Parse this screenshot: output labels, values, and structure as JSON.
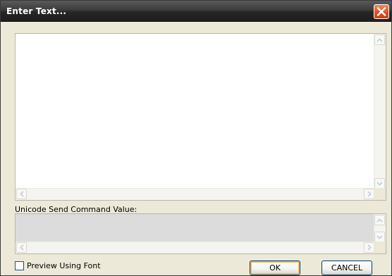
{
  "window": {
    "title": "Enter Text..."
  },
  "command": {
    "label": "Unicode Send Command Value:"
  },
  "preview": {
    "label": "Preview Using Font",
    "checked": false
  },
  "buttons": {
    "ok": "OK",
    "cancel": "CANCEL"
  },
  "icons": {
    "close": "close-icon",
    "scroll_up": "arrow-up-icon",
    "scroll_down": "arrow-down-icon",
    "scroll_left": "arrow-left-icon",
    "scroll_right": "arrow-right-icon"
  },
  "colors": {
    "titlebar": "#2a2a2a",
    "close": "#e0572a",
    "dialog": "#ece9d8",
    "ok_focus": "#f2b866"
  }
}
